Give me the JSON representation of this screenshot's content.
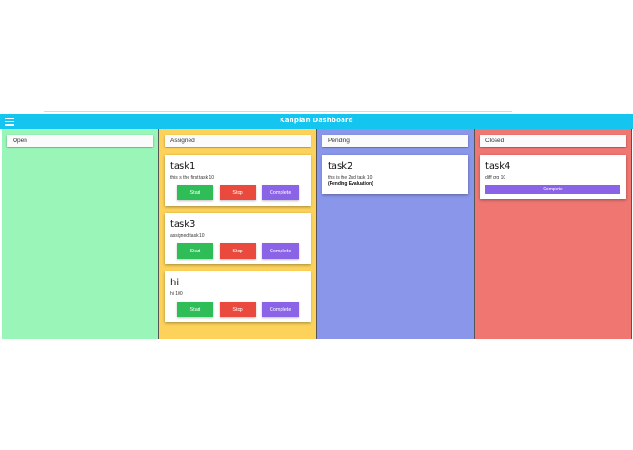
{
  "navbar": {
    "title": "Kanplan Dashboard"
  },
  "columns": [
    {
      "name": "Open",
      "color": "#9af5b8",
      "cards": []
    },
    {
      "name": "Assigned",
      "color": "#fcd25a",
      "cards": [
        {
          "title": "task1",
          "description": "this is the first task 10"
        },
        {
          "title": "task3",
          "description": "assigned task 10"
        },
        {
          "title": "hi",
          "description": "hi 100"
        }
      ]
    },
    {
      "name": "Pending",
      "color": "#8996ea",
      "cards": [
        {
          "title": "task2",
          "description": "this is the 2nd task 10",
          "note": "(Pending Evaluation)"
        }
      ]
    },
    {
      "name": "Closed",
      "color": "#f07672",
      "cards": [
        {
          "title": "task4",
          "description": "diff org 10"
        }
      ]
    }
  ],
  "buttons": {
    "start": "Start",
    "stop": "Stop",
    "complete": "Complete"
  }
}
